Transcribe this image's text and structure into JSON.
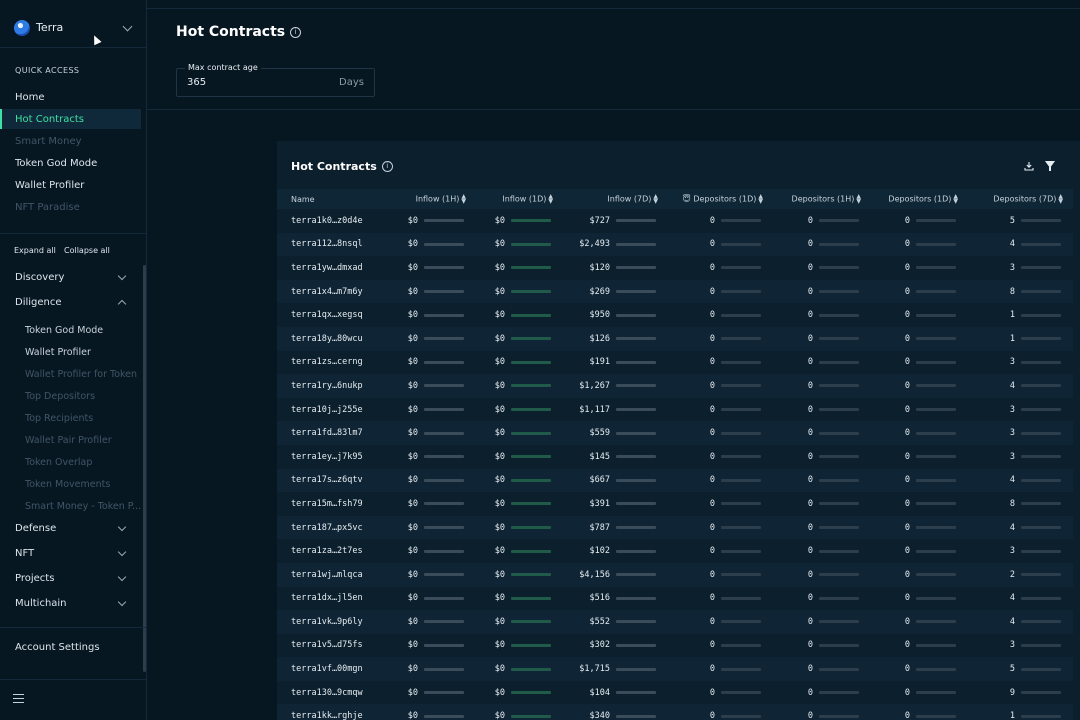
{
  "sidebar": {
    "chain": "Terra",
    "quick_access_title": "QUICK ACCESS",
    "quick_access": [
      {
        "label": "Home",
        "state": "normal"
      },
      {
        "label": "Hot Contracts",
        "state": "active"
      },
      {
        "label": "Smart Money",
        "state": "disabled"
      },
      {
        "label": "Token God Mode",
        "state": "normal"
      },
      {
        "label": "Wallet Profiler",
        "state": "normal"
      },
      {
        "label": "NFT Paradise",
        "state": "disabled"
      }
    ],
    "expand_all": "Expand all",
    "collapse_all": "Collapse all",
    "groups": {
      "discovery": "Discovery",
      "diligence": "Diligence",
      "defense": "Defense",
      "nft": "NFT",
      "projects": "Projects",
      "multichain": "Multichain"
    },
    "diligence_items": [
      {
        "label": "Token God Mode",
        "state": "normal"
      },
      {
        "label": "Wallet Profiler",
        "state": "normal"
      },
      {
        "label": "Wallet Profiler for Token",
        "state": "disabled"
      },
      {
        "label": "Top Depositors",
        "state": "disabled"
      },
      {
        "label": "Top Recipients",
        "state": "disabled"
      },
      {
        "label": "Wallet Pair Profiler",
        "state": "disabled"
      },
      {
        "label": "Token Overlap",
        "state": "disabled"
      },
      {
        "label": "Token Movements",
        "state": "disabled"
      },
      {
        "label": "Smart Money - Token P...",
        "state": "disabled"
      }
    ],
    "account_settings": "Account Settings"
  },
  "header": {
    "title": "Hot Contracts",
    "max_age_label": "Max contract age",
    "max_age_value": "365",
    "max_age_unit": "Days"
  },
  "card": {
    "title": "Hot Contracts",
    "columns": [
      "Name",
      "Inflow (1H)",
      "Inflow (1D)",
      "Inflow (7D)",
      "😇 Depositors (1D)",
      "Depositors (1H)",
      "Depositors (1D)",
      "Depositors (7D)"
    ],
    "rows": [
      [
        "terra1k0…z0d4e",
        "$0",
        "$0",
        "$727",
        "0",
        "0",
        "0",
        "5"
      ],
      [
        "terra112…8nsql",
        "$0",
        "$0",
        "$2,493",
        "0",
        "0",
        "0",
        "4"
      ],
      [
        "terra1yw…dmxad",
        "$0",
        "$0",
        "$120",
        "0",
        "0",
        "0",
        "3"
      ],
      [
        "terra1x4…m7m6y",
        "$0",
        "$0",
        "$269",
        "0",
        "0",
        "0",
        "8"
      ],
      [
        "terra1qx…xegsq",
        "$0",
        "$0",
        "$950",
        "0",
        "0",
        "0",
        "1"
      ],
      [
        "terra18y…80wcu",
        "$0",
        "$0",
        "$126",
        "0",
        "0",
        "0",
        "1"
      ],
      [
        "terra1zs…cerng",
        "$0",
        "$0",
        "$191",
        "0",
        "0",
        "0",
        "3"
      ],
      [
        "terra1ry…6nukp",
        "$0",
        "$0",
        "$1,267",
        "0",
        "0",
        "0",
        "4"
      ],
      [
        "terra10j…j255e",
        "$0",
        "$0",
        "$1,117",
        "0",
        "0",
        "0",
        "3"
      ],
      [
        "terra1fd…83lm7",
        "$0",
        "$0",
        "$559",
        "0",
        "0",
        "0",
        "3"
      ],
      [
        "terra1ey…j7k95",
        "$0",
        "$0",
        "$145",
        "0",
        "0",
        "0",
        "3"
      ],
      [
        "terra17s…z6qtv",
        "$0",
        "$0",
        "$667",
        "0",
        "0",
        "0",
        "4"
      ],
      [
        "terra15m…fsh79",
        "$0",
        "$0",
        "$391",
        "0",
        "0",
        "0",
        "8"
      ],
      [
        "terra187…px5vc",
        "$0",
        "$0",
        "$787",
        "0",
        "0",
        "0",
        "4"
      ],
      [
        "terra1za…2t7es",
        "$0",
        "$0",
        "$102",
        "0",
        "0",
        "0",
        "3"
      ],
      [
        "terra1wj…mlqca",
        "$0",
        "$0",
        "$4,156",
        "0",
        "0",
        "0",
        "2"
      ],
      [
        "terra1dx…jl5en",
        "$0",
        "$0",
        "$516",
        "0",
        "0",
        "0",
        "4"
      ],
      [
        "terra1vk…9p6ly",
        "$0",
        "$0",
        "$552",
        "0",
        "0",
        "0",
        "4"
      ],
      [
        "terra1v5…d75fs",
        "$0",
        "$0",
        "$302",
        "0",
        "0",
        "0",
        "3"
      ],
      [
        "terra1vf…00mgn",
        "$0",
        "$0",
        "$1,715",
        "0",
        "0",
        "0",
        "5"
      ],
      [
        "terra130…9cmqw",
        "$0",
        "$0",
        "$104",
        "0",
        "0",
        "0",
        "9"
      ],
      [
        "terra1kk…rghje",
        "$0",
        "$0",
        "$340",
        "0",
        "0",
        "0",
        "1"
      ]
    ]
  },
  "colors": {
    "accent": "#3fe0a3",
    "background": "#071722",
    "card": "#0b1f2d"
  }
}
